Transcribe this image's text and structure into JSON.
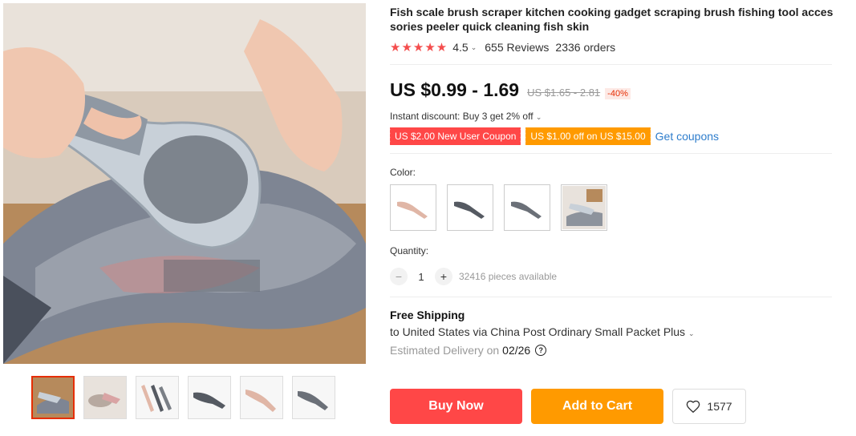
{
  "product": {
    "title": "Fish scale brush scraper kitchen cooking gadget scraping brush fishing tool accessories peeler quick cleaning fish skin",
    "stars": "★★★★★",
    "rating": "4.5",
    "reviews": "655 Reviews",
    "orders": "2336 orders",
    "price": "US $0.99 - 1.69",
    "original_price": "US $1.65 - 2.81",
    "discount": "-40%",
    "instant_discount": "Instant discount: Buy 3 get 2% off",
    "coupons": [
      {
        "label": "US $2.00 New User Coupon",
        "color": "#ff4747"
      },
      {
        "label": "US $1.00 off on US $15.00",
        "color": "#ff9a00"
      }
    ],
    "get_coupons": "Get coupons"
  },
  "options": {
    "color_label": "Color:",
    "quantity_label": "Quantity:",
    "quantity_value": "1",
    "available": "32416 pieces available"
  },
  "shipping": {
    "title": "Free Shipping",
    "to": "to United States via China Post Ordinary Small Packet Plus",
    "estimated_label": "Estimated Delivery on",
    "date": "02/26"
  },
  "actions": {
    "buy_now": "Buy Now",
    "add_to_cart": "Add to Cart",
    "wishlist_count": "1577"
  },
  "colors": {
    "accent_red": "#ff4747",
    "accent_orange": "#ff9a00",
    "link_blue": "#2e7dcc"
  }
}
